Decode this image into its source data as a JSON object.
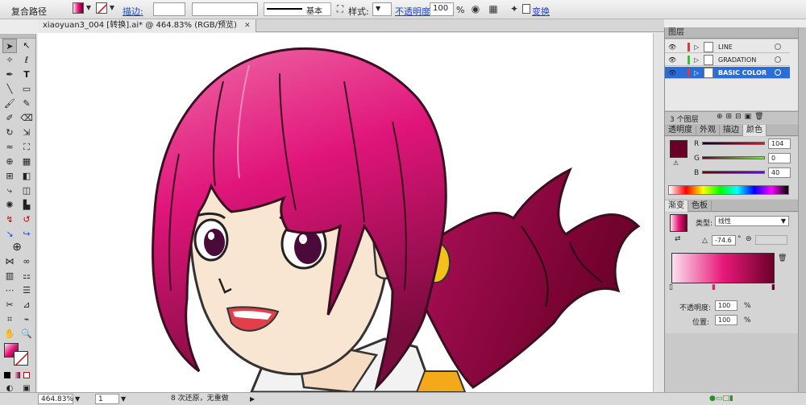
{
  "control_bar": {
    "title": "复合路径",
    "stroke_label": "描边:",
    "stroke_weight_value": "",
    "brush_profile": "",
    "stroke_style_label": "基本",
    "style_label": "样式:",
    "opacity_label": "不透明度:",
    "opacity_value": "100",
    "opacity_unit": "%",
    "transform_label": "变换"
  },
  "document": {
    "tab_title": "xiaoyuan3_004 [转换].ai* @ 464.83% (RGB/预览)",
    "close_label": "✕"
  },
  "status_bar": {
    "zoom": "464.83%",
    "artboard": "1",
    "status_text": "8 次还原，无重做"
  },
  "layers_panel": {
    "title": "图层",
    "layers": [
      {
        "name": "LINE",
        "color": "#e0383b"
      },
      {
        "name": "GRADATION",
        "color": "#33c23a"
      },
      {
        "name": "BASIC COLOR",
        "color": "#e0383b",
        "selected": true
      }
    ],
    "count_label": "3 个图层"
  },
  "color_panel": {
    "tabs": [
      "透明度",
      "外观",
      "描边",
      "颜色"
    ],
    "active_tab": "颜色",
    "channels": [
      {
        "label": "R",
        "value": "104"
      },
      {
        "label": "G",
        "value": "0"
      },
      {
        "label": "B",
        "value": "40"
      }
    ],
    "fill_color": "#680028"
  },
  "gradient_panel": {
    "tabs": [
      "渐变",
      "色板"
    ],
    "active_tab": "渐变",
    "type_label": "类型:",
    "type_value": "线性",
    "angle_value": "-74.6",
    "angle_unit": "°",
    "opacity_label": "不透明度:",
    "opacity_value": "100",
    "position_label": "位置:",
    "position_value": "100",
    "percent": "%",
    "gradient_start": "#fbe0ef",
    "gradient_mid": "#e8197a",
    "gradient_end": "#6a0028"
  }
}
